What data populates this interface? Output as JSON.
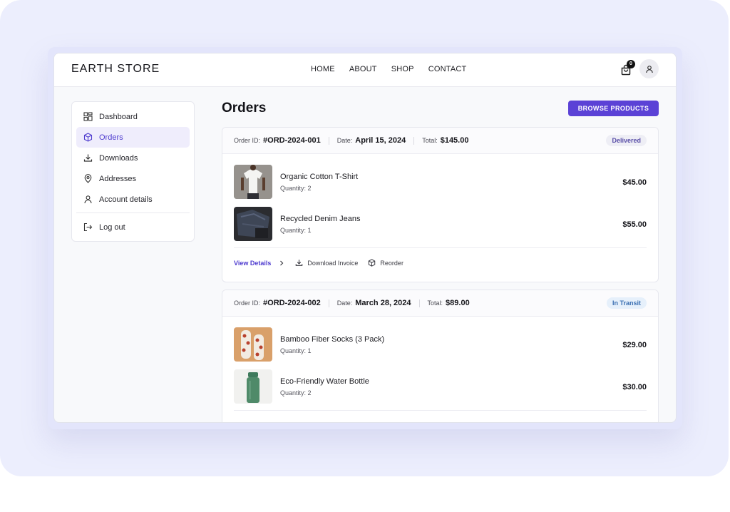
{
  "brand": "EARTH STORE",
  "nav": [
    "HOME",
    "ABOUT",
    "SHOP",
    "CONTACT"
  ],
  "cart_count": "0",
  "sidebar": {
    "items": [
      {
        "label": "Dashboard",
        "icon": "dashboard-icon"
      },
      {
        "label": "Orders",
        "icon": "box-icon",
        "active": true
      },
      {
        "label": "Downloads",
        "icon": "download-icon"
      },
      {
        "label": "Addresses",
        "icon": "map-pin-icon"
      },
      {
        "label": "Account details",
        "icon": "user-icon"
      }
    ],
    "logout": "Log out"
  },
  "page_title": "Orders",
  "browse_button": "BROWSE PRODUCTS",
  "orders": [
    {
      "id_label": "Order ID:",
      "id": "#ORD-2024-001",
      "date_label": "Date:",
      "date": "April 15, 2024",
      "total_label": "Total:",
      "total": "$145.00",
      "status": "Delivered",
      "items": [
        {
          "name": "Organic Cotton T-Shirt",
          "qty": "Quantity: 2",
          "price": "$45.00"
        },
        {
          "name": "Recycled Denim Jeans",
          "qty": "Quantity: 1",
          "price": "$55.00"
        }
      ],
      "actions": {
        "view": "View Details",
        "invoice": "Download Invoice",
        "reorder": "Reorder"
      }
    },
    {
      "id_label": "Order ID:",
      "id": "#ORD-2024-002",
      "date_label": "Date:",
      "date": "March 28, 2024",
      "total_label": "Total:",
      "total": "$89.00",
      "status": "In Transit",
      "items": [
        {
          "name": "Bamboo Fiber Socks (3 Pack)",
          "qty": "Quantity: 1",
          "price": "$29.00"
        },
        {
          "name": "Eco-Friendly Water Bottle",
          "qty": "Quantity: 2",
          "price": "$30.00"
        }
      ]
    }
  ],
  "colors": {
    "accent": "#5b42d6",
    "active_bg": "#efedfc",
    "delivered_bg": "#eeeef5",
    "transit_bg": "#e6f0fb"
  }
}
